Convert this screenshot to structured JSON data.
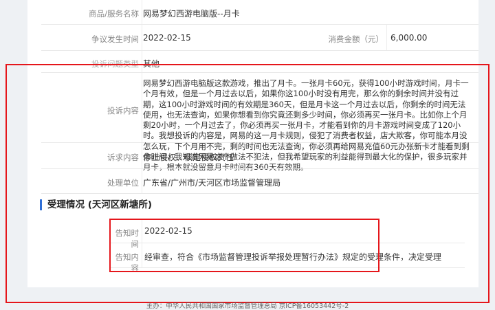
{
  "details": {
    "product_label": "商品/服务名称",
    "product_value": "网易梦幻西游电脑版--月卡",
    "dispute_date_label": "争议发生时间",
    "dispute_date_value": "2022-02-15",
    "amount_label": "消费金额（元）",
    "amount_value": "6,000.00",
    "complaint_type_label": "投诉问题类型",
    "complaint_type_value": "其他",
    "complaint_label": "投诉内容",
    "complaint_value": "网易梦幻西游电脑版这款游戏，推出了月卡。一张月卡60元，获得100小时游戏时间，月卡一个月有效，但是一个月过去以后，如果你这100小时没有用完，那么你的剩余时间并没有过期，这100小时游戏时间的有效期是360天，但是月卡这一个月过去以后，你剩余的时间无法使用，也无法查询，如果你想看到你究竟还剩多少时间，你必须再买一张月卡。比如你上个月剩20小时，一个月过去了，你必须再买一张月卡，才能看到你的月卡游戏时间变成了120小时。我想投诉的内容是，网易的这一月卡规则，侵犯了消费者权益，店大欺客，你可能本月没怎么玩，下个月用不完，剩的时间也无法查询，你必须再给网易充值60元办张新卡才能看到剩余时间，我知道网易这个做法不犯法，但我希望玩家的利益能得到最大化的保护，很多玩家并月卡，根本就没留意月卡时间有360天有效期。",
    "request_label": "诉求内容",
    "request_value": "停止侵权、核定侵权责任",
    "handler_label": "处理单位",
    "handler_value": "广东省/广州市/天河区市场监督管理局"
  },
  "acceptance": {
    "section_title": "受理情况 (天河区新塘所)",
    "notify_time_label": "告知时间",
    "notify_time_value": "2022-02-15",
    "notify_content_label": "告知内容",
    "notify_content_value": "经审查，符合《市场监督管理投诉举报处理暂行办法》规定的受理条件，决定受理"
  },
  "footer": {
    "text": "主办：中华人民共和国国家市场监督管理总局 京ICP备16053442号-2"
  },
  "colors": {
    "highlight_box": "#e5161b",
    "section_accent": "#2f6fd6"
  }
}
